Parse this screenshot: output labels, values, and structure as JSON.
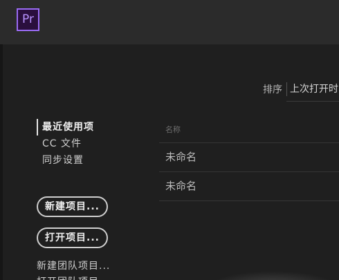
{
  "app": {
    "logo_text": "Pr",
    "colors": {
      "background": "#1f1f1f",
      "topbar": "#2b2b2b",
      "logo_fill": "#2a0f3d",
      "logo_accent": "#9b6bf5"
    }
  },
  "sort": {
    "label": "排序",
    "value": "上次打开时间"
  },
  "nav": {
    "items": [
      {
        "label": "最近使用项",
        "active": true
      },
      {
        "label": "CC 文件",
        "active": false
      },
      {
        "label": "同步设置",
        "active": false
      }
    ]
  },
  "buttons": {
    "new_project": "新建项目...",
    "open_project": "打开项目..."
  },
  "links": {
    "new_team_project": "新建团队项目...",
    "open_team_project": "打开团队项目..."
  },
  "recent_list": {
    "column_header": "名称",
    "rows": [
      "未命名",
      "未命名"
    ]
  }
}
